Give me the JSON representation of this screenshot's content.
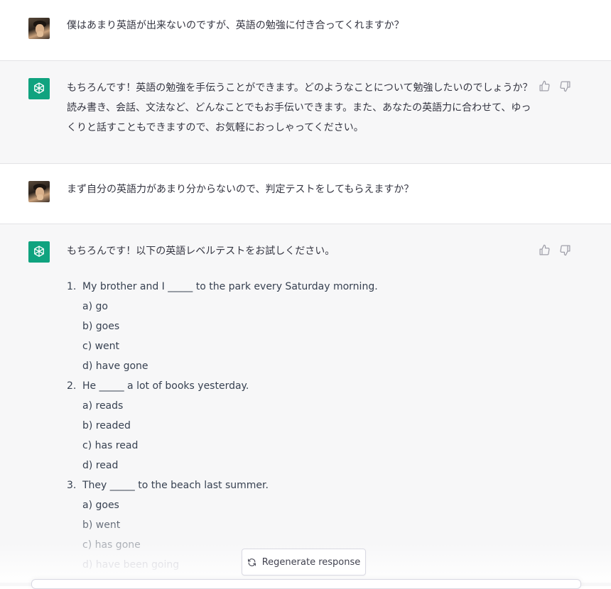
{
  "messages": [
    {
      "role": "user",
      "text": "僕はあまり英語が出来ないのですが、英語の勉強に付き合ってくれますか？"
    },
    {
      "role": "assistant",
      "text": "もちろんです！英語の勉強を手伝うことができます。どのようなことについて勉強したいのでしょうか？読み書き、会話、文法など、どんなことでもお手伝いできます。また、あなたの英語力に合わせて、ゆっくりと話すこともできますので、お気軽におっしゃってください。"
    },
    {
      "role": "user",
      "text": "まず自分の英語力があまり分からないので、判定テストをしてもらえますか？"
    },
    {
      "role": "assistant",
      "intro": "もちろんです！以下の英語レベルテストをお試しください。",
      "quiz": [
        {
          "num": "1.",
          "question": "My brother and I _____ to the park every Saturday morning.",
          "options": [
            "a) go",
            "b) goes",
            "c) went",
            "d) have gone"
          ]
        },
        {
          "num": "2.",
          "question": "He _____ a lot of books yesterday.",
          "options": [
            "a) reads",
            "b) readed",
            "c) has read",
            "d) read"
          ]
        },
        {
          "num": "3.",
          "question": "They _____ to the beach last summer.",
          "options": [
            "a) goes",
            "b) went",
            "c) has gone",
            "d) have been going"
          ]
        }
      ]
    }
  ],
  "regenerate_label": "Regenerate response",
  "colors": {
    "bot_avatar": "#10a37f",
    "assistant_bg": "#f7f7f8",
    "user_bg": "#ffffff",
    "text": "#343541"
  },
  "icons": {
    "thumbs_up": "thumbs-up-icon",
    "thumbs_down": "thumbs-down-icon",
    "regenerate": "refresh-icon",
    "bot": "openai-logo-icon"
  }
}
